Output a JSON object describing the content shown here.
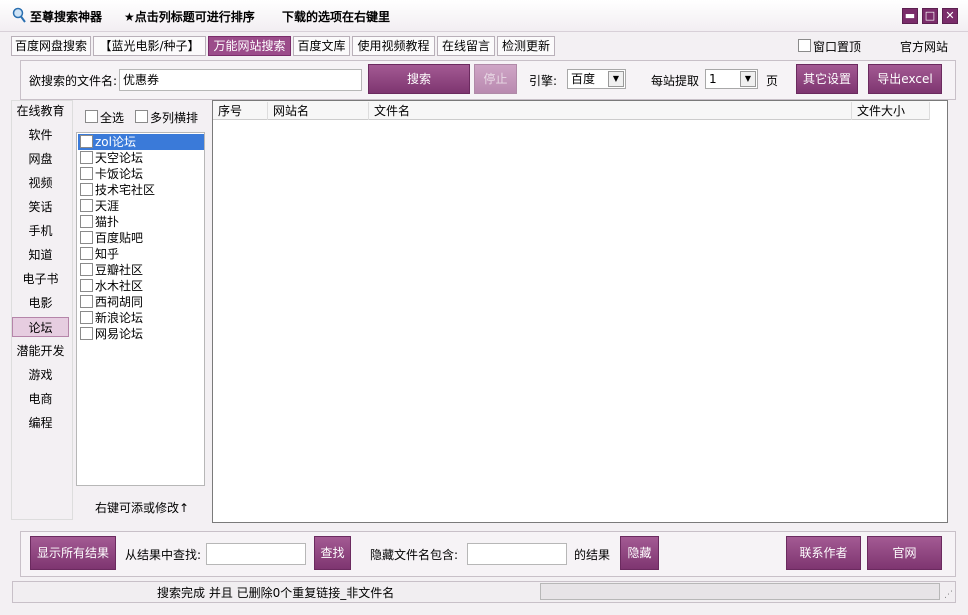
{
  "titlebar": {
    "app_title": "至尊搜索神器",
    "hint_sort": "★点击列标题可进行排序",
    "hint_download": "下载的选项在右键里",
    "minimize": "▬",
    "maximize": "□",
    "close": "✕"
  },
  "tabs": [
    {
      "label": "百度网盘搜索"
    },
    {
      "label": "【蓝光电影/种子】"
    },
    {
      "label": "万能网站搜索"
    },
    {
      "label": "百度文库"
    },
    {
      "label": "使用视频教程"
    },
    {
      "label": "在线留言"
    },
    {
      "label": "检测更新"
    }
  ],
  "topright": {
    "pin_label": "窗口置顶",
    "official_site": "官方网站"
  },
  "search": {
    "label": "欲搜索的文件名:",
    "value": "优惠券",
    "search_button": "搜索",
    "stop_button": "停止",
    "engine_label": "引擎:",
    "engine_value": "百度",
    "per_site_label": "每站提取",
    "per_site_value": "1",
    "page_unit": "页",
    "other_settings": "其它设置",
    "export_excel": "导出excel"
  },
  "categories": [
    "在线教育",
    "软件",
    "网盘",
    "视频",
    "笑话",
    "手机",
    "知道",
    "电子书",
    "电影",
    "论坛",
    "潜能开发",
    "游戏",
    "电商",
    "编程"
  ],
  "category_selected": "论坛",
  "site_list": {
    "select_all": "全选",
    "multi_column": "多列横排",
    "items": [
      "zol论坛",
      "天空论坛",
      "卡饭论坛",
      "技术宅社区",
      "天涯",
      "猫扑",
      "百度贴吧",
      "知乎",
      "豆瓣社区",
      "水木社区",
      "西祠胡同",
      "新浪论坛",
      "网易论坛"
    ],
    "footer_hint": "右键可添或修改↑"
  },
  "results_table": {
    "columns": [
      "序号",
      "网站名",
      "文件名",
      "文件大小"
    ]
  },
  "bottom": {
    "show_all": "显示所有结果",
    "find_label": "从结果中查找:",
    "find_value": "",
    "find_button": "查找",
    "hide_label": "隐藏文件名包含:",
    "hide_value": "",
    "hide_suffix": "的结果",
    "hide_button": "隐藏",
    "contact_author": "联系作者",
    "official": "官网"
  },
  "status": {
    "text": "搜索完成 并且 已删除0个重复链接_非文件名"
  },
  "colors": {
    "accent": "#8b3f7d",
    "selection": "#3a7ad9"
  }
}
